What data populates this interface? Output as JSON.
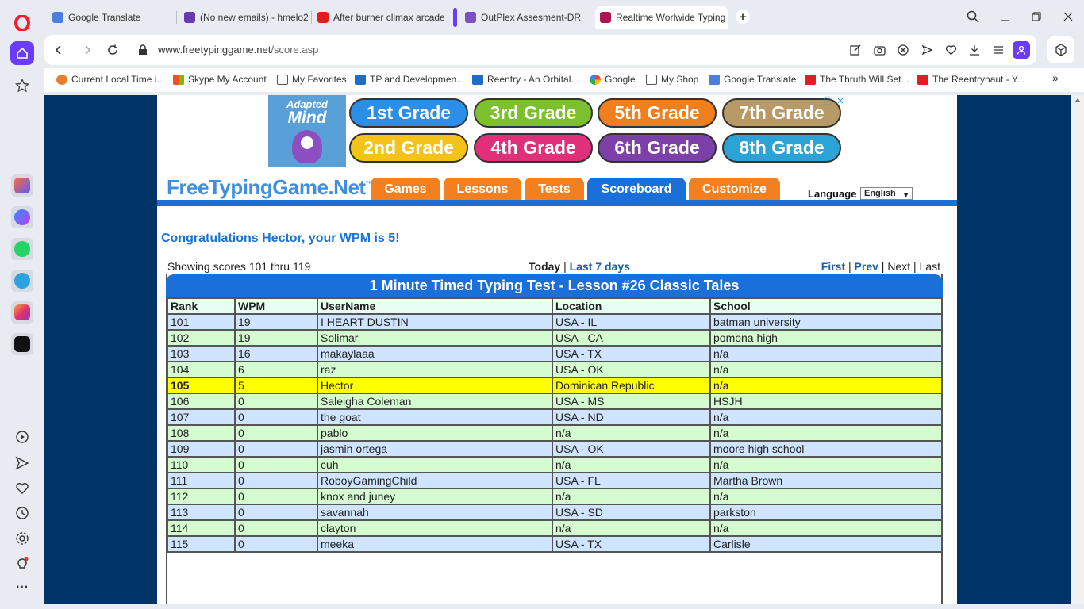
{
  "browser": {
    "tabs": [
      {
        "title": "Google Translate",
        "color": "#4a7fe0"
      },
      {
        "title": "(No new emails) - hmelo2",
        "color": "#6a39b0"
      },
      {
        "title": "After burner climax arcade",
        "color": "#e02020"
      },
      {
        "title": "OutPlex Assesment-DR",
        "color": "#7b4fc8"
      },
      {
        "title": "Realtime Worlwide Typing",
        "color": "#b0144e"
      }
    ],
    "url_domain": "www.freetypinggame.net",
    "url_path": "/score.asp",
    "bookmarks": [
      {
        "label": "Current Local Time i...",
        "color": "#e57f2e"
      },
      {
        "label": "Skype My Account",
        "color": "#2e8fe0"
      },
      {
        "label": "My Favorites",
        "color": "#555555"
      },
      {
        "label": "TP and Developmen...",
        "color": "#1e6ec8"
      },
      {
        "label": "Reentry - An Orbital...",
        "color": "#1e6ec8"
      },
      {
        "label": "Google",
        "color": "#4285f4"
      },
      {
        "label": "My Shop",
        "color": "#555555"
      },
      {
        "label": "Google Translate",
        "color": "#4a7fe0"
      },
      {
        "label": "The Thruth Will Set...",
        "color": "#e02020"
      },
      {
        "label": "The Reentrynaut - Y...",
        "color": "#e02020"
      }
    ],
    "more_bookmarks": "»"
  },
  "ad": {
    "logo_line1": "Adapted",
    "logo_line2": "Mind",
    "grades": [
      {
        "label": "1st Grade",
        "color": "#2b8fe8"
      },
      {
        "label": "3rd Grade",
        "color": "#7cc02e"
      },
      {
        "label": "5th Grade",
        "color": "#f07f1c"
      },
      {
        "label": "7th Grade",
        "color": "#b89a66"
      },
      {
        "label": "2nd Grade",
        "color": "#f5c21a"
      },
      {
        "label": "4th Grade",
        "color": "#e0307a"
      },
      {
        "label": "6th Grade",
        "color": "#7d3fa8"
      },
      {
        "label": "8th Grade",
        "color": "#2ba3d6"
      }
    ]
  },
  "site": {
    "logo": "FreeTypingGame.Net",
    "logo_tm": "™",
    "nav": [
      "Games",
      "Lessons",
      "Tests",
      "Scoreboard",
      "Customize"
    ],
    "active_nav": "Scoreboard",
    "language_label": "Language",
    "language_value": "English"
  },
  "scores": {
    "congrats": "Congratulations Hector, your WPM is 5!",
    "showing": "Showing scores 101 thru 119",
    "period_current": "Today",
    "period_link": "Last 7 days",
    "pager": {
      "first": "First",
      "prev": "Prev",
      "next": "Next",
      "last": "Last"
    },
    "title": "1 Minute Timed Typing Test - Lesson #26 Classic Tales",
    "columns": [
      "Rank",
      "WPM",
      "UserName",
      "Location",
      "School"
    ],
    "highlight_rank": "105",
    "rows": [
      [
        "101",
        "19",
        "I HEART DUSTIN",
        "USA - IL",
        "batman university"
      ],
      [
        "102",
        "19",
        "Solimar",
        "USA - CA",
        "pomona high"
      ],
      [
        "103",
        "16",
        "makaylaaa",
        "USA - TX",
        "n/a"
      ],
      [
        "104",
        "6",
        "raz",
        "USA - OK",
        "n/a"
      ],
      [
        "105",
        "5",
        "Hector",
        "Dominican Republic",
        "n/a"
      ],
      [
        "106",
        "0",
        "Saleigha Coleman",
        "USA - MS",
        "HSJH"
      ],
      [
        "107",
        "0",
        "the goat",
        "USA - ND",
        "n/a"
      ],
      [
        "108",
        "0",
        "pablo",
        "n/a",
        "n/a"
      ],
      [
        "109",
        "0",
        "jasmin ortega",
        "USA - OK",
        "moore high school"
      ],
      [
        "110",
        "0",
        "cuh",
        "n/a",
        "n/a"
      ],
      [
        "111",
        "0",
        "RoboyGamingChild",
        "USA - FL",
        "Martha Brown"
      ],
      [
        "112",
        "0",
        "knox and juney",
        "n/a",
        "n/a"
      ],
      [
        "113",
        "0",
        "savannah",
        "USA - SD",
        "parkston"
      ],
      [
        "114",
        "0",
        "clayton",
        "n/a",
        "n/a"
      ],
      [
        "115",
        "0",
        "meeka",
        "USA - TX",
        "Carlisle"
      ]
    ]
  }
}
